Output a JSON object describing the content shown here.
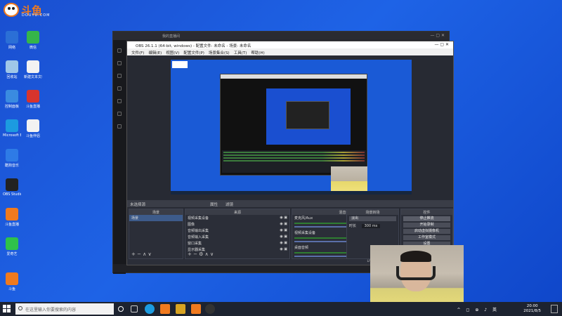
{
  "watermark": {
    "brand": "斗鱼",
    "sub": "DOUYU.COM"
  },
  "desktop_icons": [
    {
      "label": "网络",
      "color": "#2b6fd6"
    },
    {
      "label": "微信",
      "color": "#35b54a"
    },
    {
      "label": "回收站",
      "color": "#9fc7e8"
    },
    {
      "label": "新建文本文档",
      "color": "#f2f2f2"
    },
    {
      "label": "控制面板",
      "color": "#3a8be0"
    },
    {
      "label": "斗鱼直播",
      "color": "#d8342c"
    },
    {
      "label": "Microsoft Edge",
      "color": "#1c9be0"
    },
    {
      "label": "斗鱼伴侣",
      "color": "#f2f2f2"
    },
    {
      "label": "酷狗音乐",
      "color": "#2e7be6"
    },
    {
      "label": "OBS Studio",
      "color": "#222"
    },
    {
      "label": "斗鱼直播",
      "color": "#f07a1e"
    },
    {
      "label": "爱奇艺",
      "color": "#2fc24a"
    },
    {
      "label": "斗鱼",
      "color": "#f07a1e"
    }
  ],
  "douyu_window": {
    "title": "我的直播间"
  },
  "obs": {
    "title": "OBS 26.1.1 (64-bit, windows) - 配置文件: 未命名 - 场景: 未命名",
    "menu": [
      "文件(F)",
      "编辑(E)",
      "视图(V)",
      "配置文件(P)",
      "场景集合(S)",
      "工具(T)",
      "帮助(H)"
    ],
    "status_left": "未选择源",
    "status_props": "属性",
    "status_filters": "滤镜",
    "docks": {
      "scenes": {
        "title": "场景",
        "items": [
          "场景"
        ]
      },
      "sources": {
        "title": "来源",
        "items": [
          "视频采集设备",
          "图像",
          "音频输出采集",
          "音频输入采集",
          "窗口采集",
          "显示器采集"
        ]
      },
      "mixer": {
        "title": "混音器",
        "channels": [
          {
            "name": "麦克风/Aux",
            "db": "0.0 dB"
          },
          {
            "name": "视频采集设备",
            "db": "0.0 dB"
          },
          {
            "name": "桌面音频",
            "db": "0.0 dB"
          }
        ]
      },
      "transitions": {
        "title": "场景转场",
        "type": "淡出",
        "duration_label": "时长",
        "duration": "300 ms"
      },
      "controls": {
        "title": "控件",
        "buttons": [
          "停止推流",
          "开始录制",
          "启动虚拟摄像机",
          "工作室模式",
          "设置",
          "退出"
        ]
      }
    },
    "statusbar": {
      "live": "LIVE: 00:03:33",
      "rec": "REC: 00:00:00",
      "cpu": "CPU: 5.3%, 30.00 fps"
    }
  },
  "taskbar": {
    "search_placeholder": "在这里输入你要搜索的内容",
    "time": "20:00",
    "date": "2021/8/5",
    "tray": "^ ◻ ⊕ ♪ 英"
  },
  "colors": {
    "desktop": "#1e63e6",
    "obs_bg": "#272a33",
    "douyu_orange": "#f07a1e"
  }
}
